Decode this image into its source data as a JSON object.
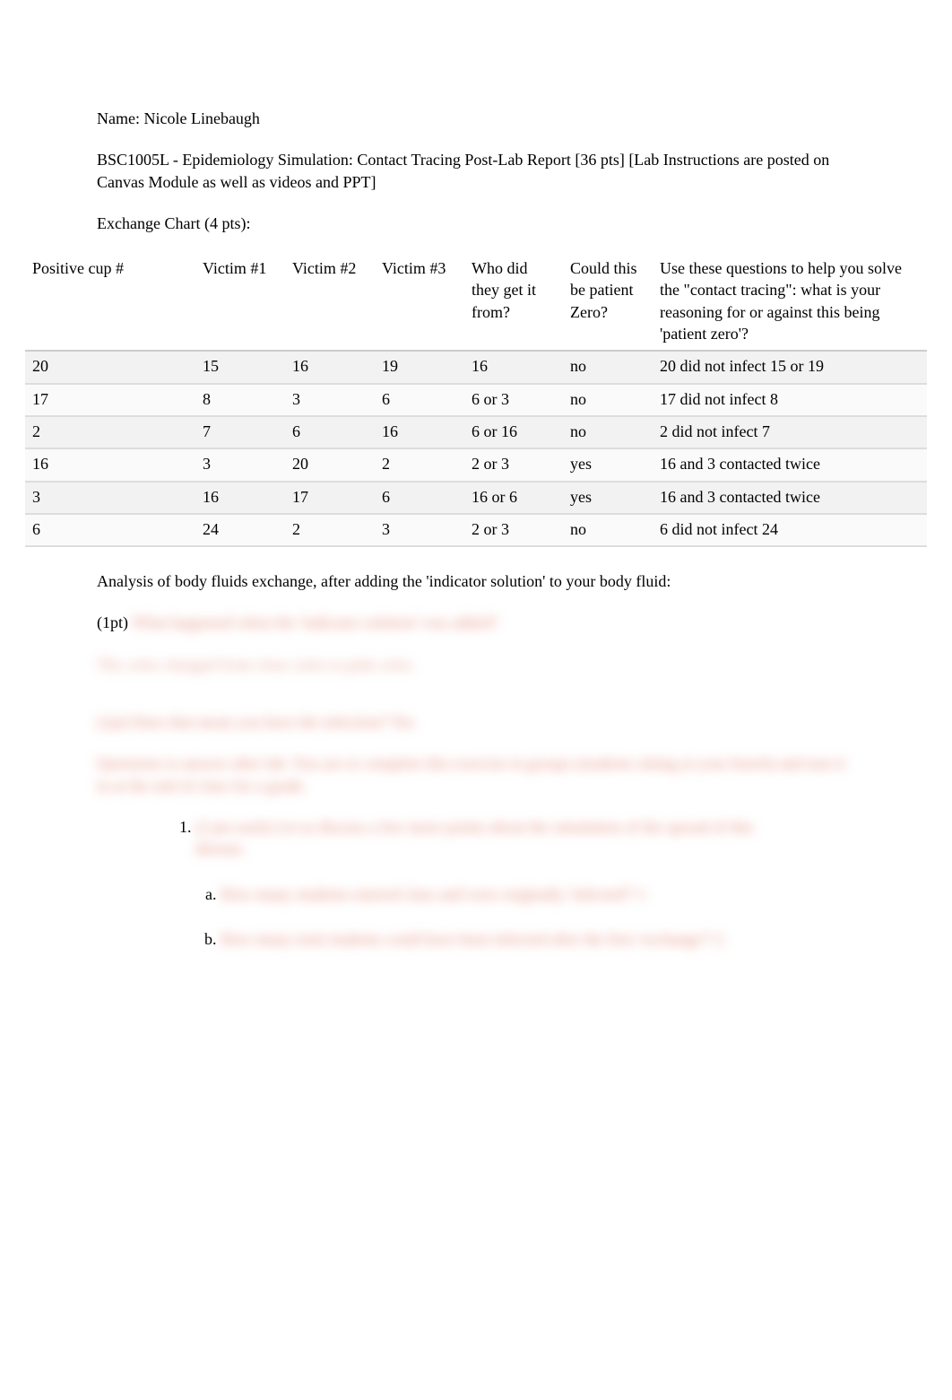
{
  "header": {
    "name_label": "Name: Nicole Linebaugh",
    "title_line": "BSC1005L - Epidemiology Simulation: Contact Tracing Post-Lab Report [36 pts] [Lab Instructions are posted on Canvas Module as well as videos and PPT]",
    "exchange_chart": "Exchange Chart (4 pts):"
  },
  "table": {
    "headers": {
      "positive": "Positive cup #",
      "v1": "Victim #1",
      "v2": "Victim #2",
      "v3": "Victim #3",
      "who": "Who did they get it from?",
      "pz": "Could this be patient Zero?",
      "reason": "Use these questions to help you solve the \"contact tracing\": what is your reasoning for or against this being 'patient zero'?"
    },
    "rows": [
      {
        "positive": "20",
        "v1": "15",
        "v2": "16",
        "v3": "19",
        "who": "16",
        "pz": "no",
        "reason": "20 did not infect 15 or 19"
      },
      {
        "positive": "17",
        "v1": "8",
        "v2": "3",
        "v3": "6",
        "who": "6 or 3",
        "pz": "no",
        "reason": "17 did not infect 8"
      },
      {
        "positive": "2",
        "v1": "7",
        "v2": "6",
        "v3": "16",
        "who": "6 or 16",
        "pz": "no",
        "reason": "2 did not infect 7"
      },
      {
        "positive": "16",
        "v1": "3",
        "v2": "20",
        "v3": "2",
        "who": "2 or 3",
        "pz": "yes",
        "reason": "16 and 3 contacted twice"
      },
      {
        "positive": "3",
        "v1": "16",
        "v2": "17",
        "v3": "6",
        "who": "16 or 6",
        "pz": "yes",
        "reason": "16 and 3 contacted twice"
      },
      {
        "positive": "6",
        "v1": "24",
        "v2": "2",
        "v3": "3",
        "who": "2 or 3",
        "pz": "no",
        "reason": "6 did not infect 24"
      }
    ]
  },
  "analysis": {
    "intro": "Analysis of body fluids exchange, after adding the 'indicator solution' to your body fluid:",
    "q1_prefix": "(1pt)",
    "q1_blurred": " What happened when the 'indicator solution' was added?",
    "a1_blurred": "The color changed from clear color to pink color.",
    "q2_blurred": "(1pt) Does that mean you have the infection? Yes",
    "instr_blurred": "Questions to answer after lab. You are to complete this exercise in groups (students sitting at your bench) and turn it in at the end of class for a grade.",
    "num1_blurred": "(2 pts each)  Let us discuss a few more points about the simulation of the spread of this disease.",
    "num1a_blurred": "How many students entered class and were originally 'infected'? 1",
    "num1b_blurred": "How many total students could have been infected after the first 'exchange'? 2"
  }
}
